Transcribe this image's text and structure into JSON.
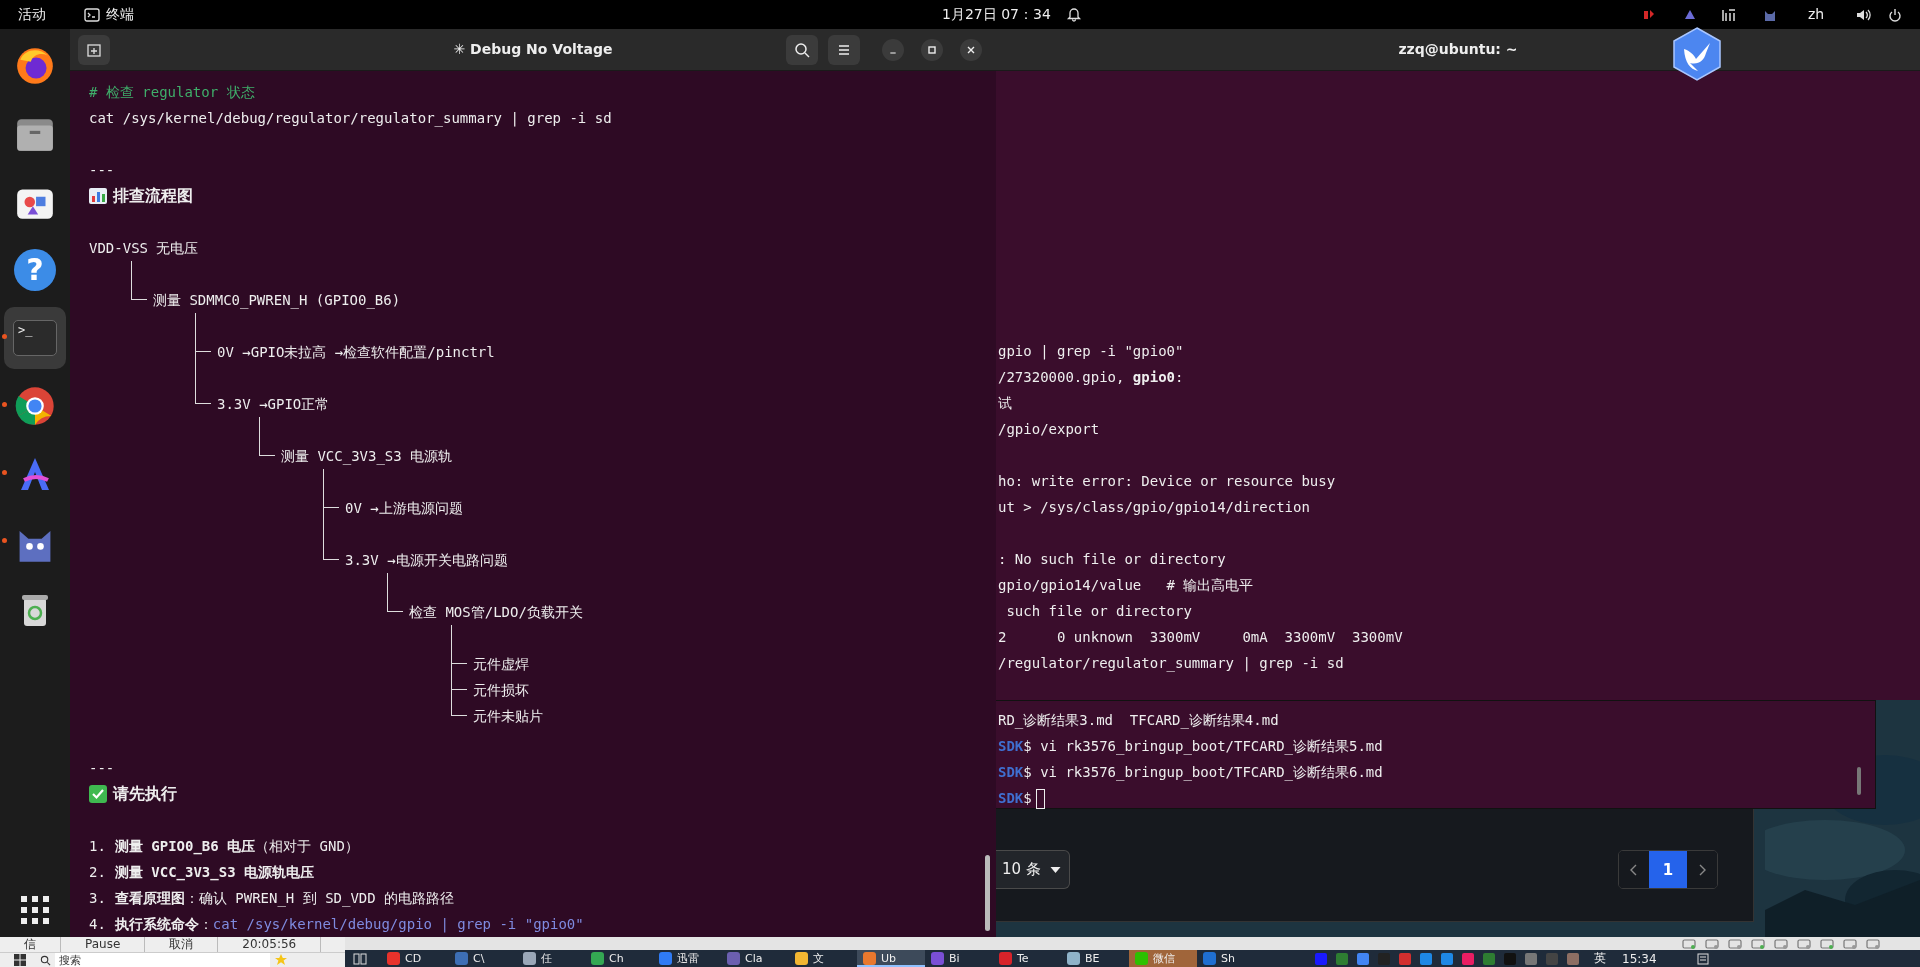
{
  "top_bar": {
    "activities": "活动",
    "app_name": "终端",
    "clock": "1月27日 07：34",
    "input_method": "zh"
  },
  "dock": {
    "items": [
      {
        "kind": "firefox",
        "running": false,
        "selected": false
      },
      {
        "kind": "files",
        "running": false,
        "selected": false
      },
      {
        "kind": "store",
        "running": false,
        "selected": false
      },
      {
        "kind": "help",
        "glyph": "?",
        "running": false,
        "selected": false
      },
      {
        "kind": "terminal",
        "glyph": ">_",
        "running": true,
        "selected": true
      },
      {
        "kind": "chrome",
        "running": true,
        "selected": false
      },
      {
        "kind": "letter-app",
        "running": true,
        "selected": false
      },
      {
        "kind": "cat",
        "running": true,
        "selected": false
      },
      {
        "kind": "trash",
        "running": false,
        "selected": false
      }
    ]
  },
  "debug_window": {
    "title": "✳ Debug No Voltage",
    "comment": "# 检查 regulator 状态",
    "command": "cat /sys/kernel/debug/regulator/regulator_summary | grep -i sd",
    "rule_1": "---",
    "heading_1": "排查流程图",
    "flowchart": {
      "text": "VDD-VSS 无电压",
      "children": [
        {
          "text": "测量 SDMMC0_PWREN_H (GPIO0_B6)",
          "children": [
            {
              "text": "0V →GPIO未拉高 →检查软件配置/pinctrl"
            },
            {
              "text": "3.3V →GPIO正常",
              "children": [
                {
                  "text": "测量 VCC_3V3_S3 电源轨",
                  "children": [
                    {
                      "text": "0V →上游电源问题"
                    },
                    {
                      "text": "3.3V →电源开关电路问题",
                      "children": [
                        {
                          "text": "检查 MOS管/LDO/负载开关",
                          "children": [
                            {
                              "text": "元件虚焊"
                            },
                            {
                              "text": "元件损坏"
                            },
                            {
                              "text": "元件未贴片"
                            }
                          ]
                        }
                      ]
                    }
                  ]
                }
              ]
            }
          ]
        }
      ]
    },
    "rule_2": "---",
    "heading_2": "请先执行",
    "steps": [
      {
        "number": "1.",
        "text": "**测量 GPIO0_B6 电压**（相对于 GND）"
      },
      {
        "number": "2.",
        "text": "**测量 VCC_3V3_S3 电源轨电压**"
      },
      {
        "number": "3.",
        "text": "**查看原理图**：确认 PWREN_H 到 SD_VDD 的电路路径"
      },
      {
        "number": "4.",
        "text": "**执行系统命令**：",
        "code": "cat /sys/kernel/debug/gpio | grep -i \"gpio0\""
      }
    ]
  },
  "terminal_window": {
    "title": "zzq@ubuntu: ~",
    "blocks": [
      [
        "gpio | grep -i \"gpio0\"",
        "/27320000.gpio, **gpio0**:",
        "试",
        "/gpio/export"
      ],
      [
        "ho: write error: Device or resource busy",
        "ut > /sys/class/gpio/gpio14/direction"
      ],
      [
        ": No such file or directory",
        "gpio/gpio14/value   # 输出高电平",
        " such file or directory",
        "2      0 unknown  3300mV     0mA  3300mV  3300mV",
        "/regulator/regulator_summary | grep -i sd"
      ]
    ]
  },
  "lower_terminal": {
    "lines": [
      {
        "text": "RD_诊断结果3.md  TFCARD_诊断结果4.md",
        "cursor": false
      },
      {
        "prompt": "SDK",
        "text": "$ vi rk3576_bringup_boot/TFCARD_诊断结果5.md",
        "cursor": false
      },
      {
        "prompt": "SDK",
        "text": "$ vi rk3576_bringup_boot/TFCARD_诊断结果6.md",
        "cursor": false
      },
      {
        "prompt": "SDK",
        "text": "$",
        "cursor": true
      }
    ]
  },
  "pager": {
    "page_size": "10 条",
    "pages": [
      {
        "label": "1",
        "selected": true
      }
    ]
  },
  "task_strip": {
    "cells": [
      "信",
      "Pause",
      "取消",
      "20:05:56"
    ]
  },
  "taskbar": {
    "search_placeholder": "搜索",
    "apps": [
      {
        "label": "CD",
        "color": "#e8322b",
        "selected": false,
        "flashing": false
      },
      {
        "label": "C\\",
        "color": "#3d6fb5",
        "selected": false,
        "flashing": false
      },
      {
        "label": "任",
        "color": "#9aa7b8",
        "selected": false,
        "flashing": false
      },
      {
        "label": "Ch",
        "color": "#34a853",
        "selected": false,
        "flashing": false
      },
      {
        "label": "迅雷",
        "color": "#2f7bf5",
        "selected": false,
        "flashing": false
      },
      {
        "label": "Cla",
        "color": "#6b5fb0",
        "selected": false,
        "flashing": false
      },
      {
        "label": "文",
        "color": "#f2b632",
        "selected": false,
        "flashing": false
      },
      {
        "label": "Ub",
        "color": "#e9782e",
        "selected": true,
        "flashing": false
      },
      {
        "label": "Bi",
        "color": "#7a4fd6",
        "selected": false,
        "flashing": false
      },
      {
        "label": "Te",
        "color": "#d8232a",
        "selected": false,
        "flashing": false
      },
      {
        "label": "BE",
        "color": "#8fb3c9",
        "selected": false,
        "flashing": false
      },
      {
        "label": "微信",
        "color": "#2dc100",
        "selected": false,
        "flashing": true
      },
      {
        "label": "Sh",
        "color": "#1f6fd1",
        "selected": false,
        "flashing": false
      }
    ],
    "ime": "英",
    "clock": "15:34"
  }
}
